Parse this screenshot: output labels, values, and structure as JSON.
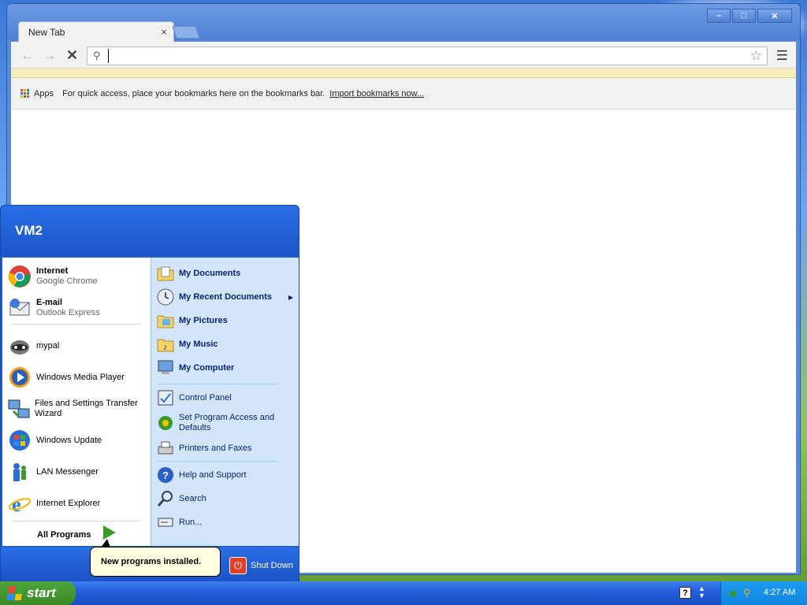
{
  "browser": {
    "tab_title": "New Tab",
    "tab_close": "×",
    "omnibox_value": "",
    "bookmarks_bar": {
      "apps_label": "Apps",
      "message": "For quick access, place your bookmarks here on the bookmarks bar.",
      "import_link": "Import bookmarks now..."
    },
    "window_buttons": {
      "minimize": "–",
      "maximize": "□",
      "close": "✕"
    }
  },
  "start_menu": {
    "user_name": "VM2",
    "pinned": [
      {
        "title": "Internet",
        "subtitle": "Google Chrome",
        "icon": "chrome-icon"
      },
      {
        "title": "E-mail",
        "subtitle": "Outlook Express",
        "icon": "outlook-express-icon"
      }
    ],
    "recent": [
      {
        "label": "mypal",
        "icon": "mypal-icon"
      },
      {
        "label": "Windows Media Player",
        "icon": "media-player-icon"
      },
      {
        "label": "Files and Settings Transfer Wizard",
        "icon": "transfer-wizard-icon"
      },
      {
        "label": "Windows Update",
        "icon": "windows-update-icon"
      },
      {
        "label": "LAN Messenger",
        "icon": "lan-messenger-icon"
      },
      {
        "label": "Internet Explorer",
        "icon": "internet-explorer-icon"
      }
    ],
    "all_programs": "All Programs",
    "right_top": [
      {
        "label": "My Documents",
        "icon": "folder-documents-icon"
      },
      {
        "label": "My Recent Documents",
        "icon": "recent-documents-icon"
      },
      {
        "label": "My Pictures",
        "icon": "folder-pictures-icon"
      },
      {
        "label": "My Music",
        "icon": "folder-music-icon"
      },
      {
        "label": "My Computer",
        "icon": "computer-icon"
      }
    ],
    "right_mid": [
      {
        "label": "Control Panel",
        "icon": "control-panel-icon"
      },
      {
        "label": "Set Program Access and Defaults",
        "icon": "program-defaults-icon"
      },
      {
        "label": "Printers and Faxes",
        "icon": "printer-icon"
      }
    ],
    "right_bottom": [
      {
        "label": "Help and Support",
        "icon": "help-icon"
      },
      {
        "label": "Search",
        "icon": "search-icon"
      },
      {
        "label": "Run...",
        "icon": "run-icon"
      }
    ],
    "shutdown": "Shut Down"
  },
  "balloon": {
    "text": "New programs installed."
  },
  "taskbar": {
    "start_label": "start",
    "clock": "4:27 AM"
  },
  "colors": {
    "xp_blue": "#245edb",
    "start_green": "#3a8a26",
    "menu_right_bg": "#d3e5fa",
    "balloon_bg": "#ffffe1"
  }
}
